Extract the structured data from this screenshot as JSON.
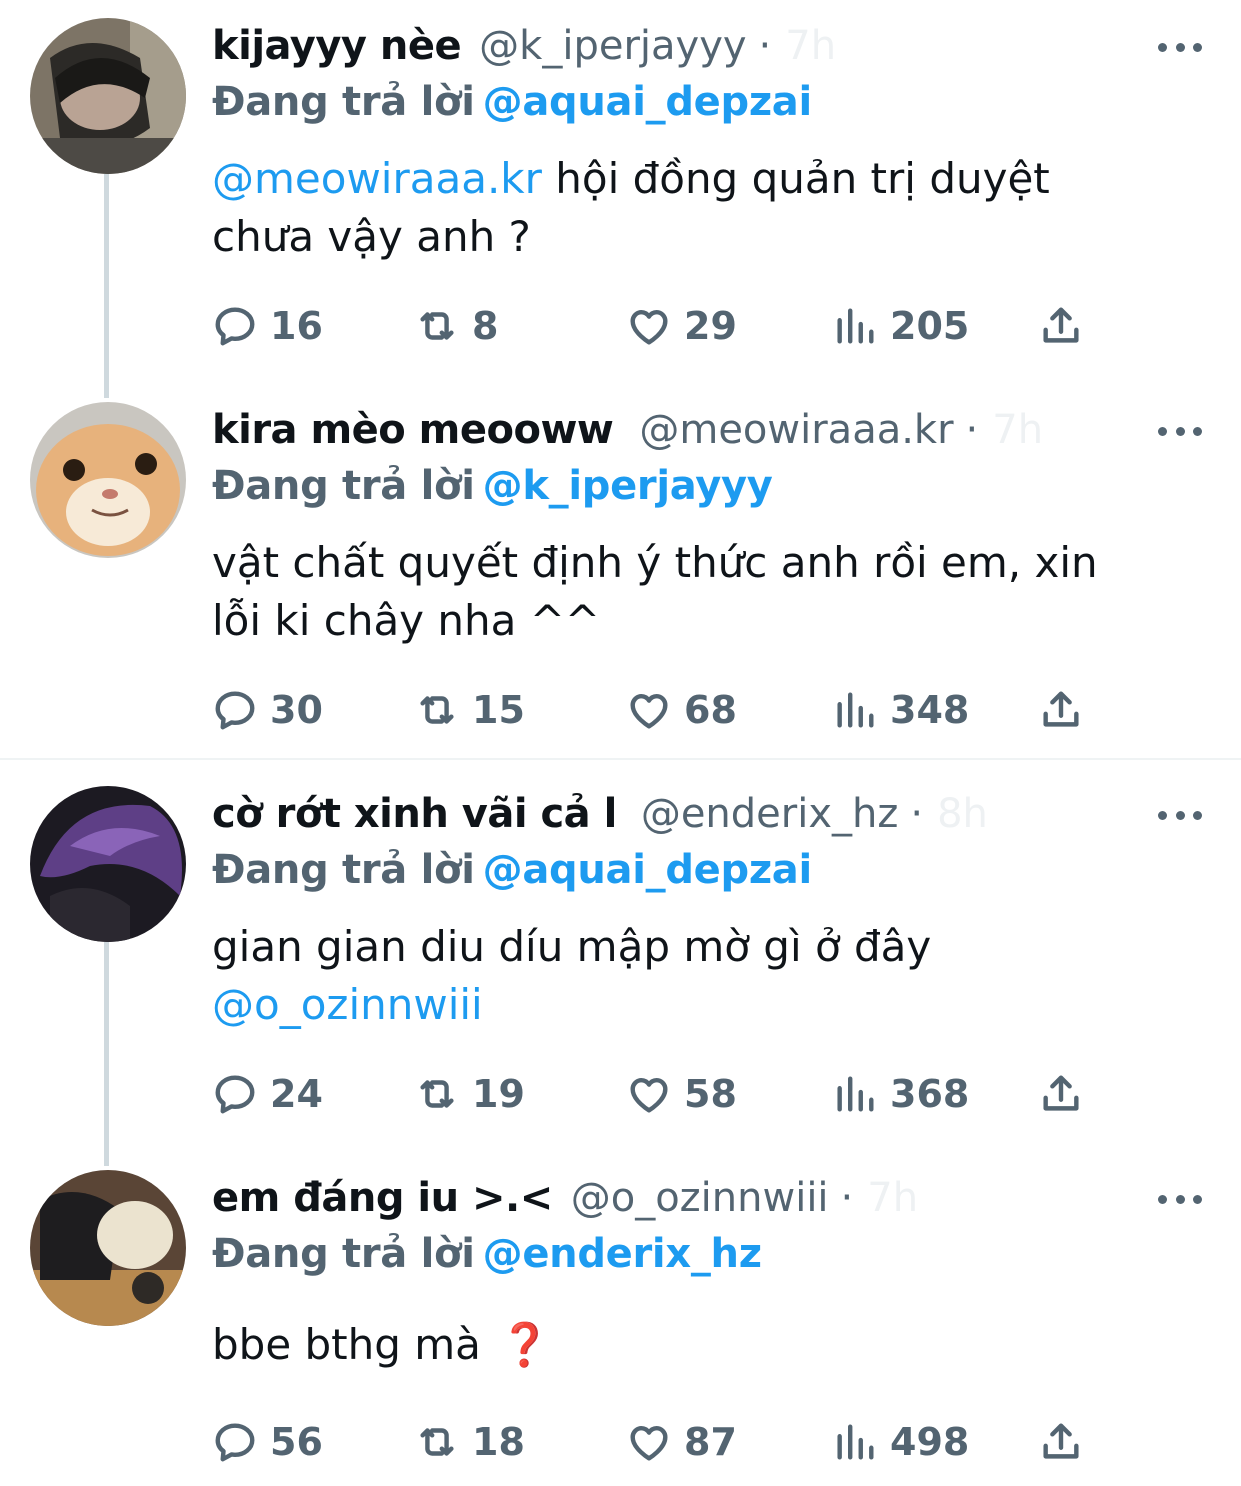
{
  "tweets": [
    {
      "name": "kijayyy nèe",
      "handle": "@k_iperjayyy",
      "time": "7h",
      "reply_prefix": "Đang trả lời",
      "reply_to": "@aquai_depzai",
      "body_mention": "@meowiraaa.kr",
      "body_line1": "hội đồng quản trị duyệt",
      "body_line2": "chưa vậy anh ?",
      "replies": "16",
      "retweets": "8",
      "likes": "29",
      "views": "205"
    },
    {
      "name": "kira mèo meooww",
      "handle": "@meowiraaa.kr",
      "time": "7h",
      "reply_prefix": "Đang trả lời",
      "reply_to": "@k_iperjayyy",
      "body_line1": "vật chất quyết định ý thức anh rồi em, xin",
      "body_line2": "lỗi ki chây nha ^^",
      "replies": "30",
      "retweets": "15",
      "likes": "68",
      "views": "348"
    },
    {
      "name": "cờ rớt xinh vãi cả l",
      "handle": "@enderix_hz",
      "time": "8h",
      "reply_prefix": "Đang trả lời",
      "reply_to": "@aquai_depzai",
      "body_line1": "gian gian diu díu mập mờ gì ở đây",
      "body_mention": "@o_ozinnwiii",
      "replies": "24",
      "retweets": "19",
      "likes": "58",
      "views": "368"
    },
    {
      "name": "em đáng iu >.<",
      "handle": "@o_ozinnwiii",
      "time": "7h",
      "reply_prefix": "Đang trả lời",
      "reply_to": "@enderix_hz",
      "body_line1": "bbe bthg mà",
      "body_emoji": "❓",
      "replies": "56",
      "retweets": "18",
      "likes": "87",
      "views": "498"
    }
  ],
  "icons": {
    "reply": "reply-bubble-icon",
    "retweet": "retweet-icon",
    "like": "heart-icon",
    "views": "views-bar-chart-icon",
    "share": "share-upload-icon",
    "more": "more-dots-icon"
  },
  "colors": {
    "link": "#1d9bf0",
    "secondary": "#536471",
    "text": "#0f1419",
    "thread_line": "#cfd9de"
  }
}
